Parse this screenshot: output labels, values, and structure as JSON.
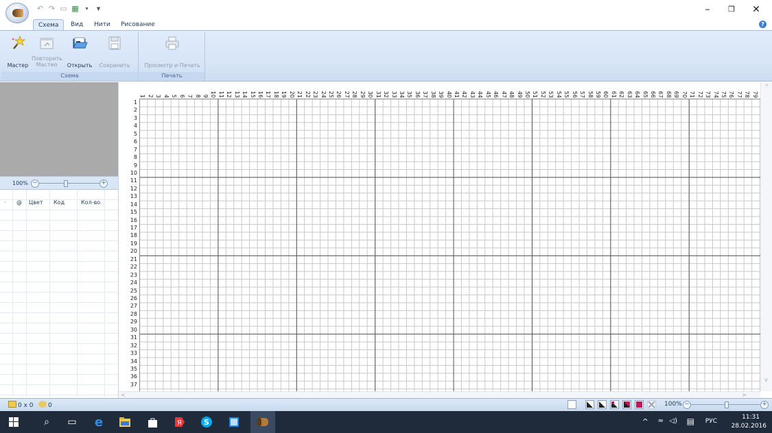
{
  "window": {
    "minimize": "–",
    "maximize": "❐",
    "close": "✕"
  },
  "quick_access": {
    "undo_icon": "undo-icon",
    "redo_icon": "redo-icon",
    "save_icon": "save-icon",
    "thread_icon": "thread-icon",
    "customize": "▾"
  },
  "tabs": [
    {
      "label": "Схема",
      "active": true
    },
    {
      "label": "Вид",
      "active": false
    },
    {
      "label": "Нити",
      "active": false
    },
    {
      "label": "Рисование",
      "active": false
    }
  ],
  "ribbon": {
    "schema_group": {
      "label": "Схема",
      "buttons": [
        {
          "label": "Мастер",
          "enabled": true
        },
        {
          "label": "Повторить Мастео",
          "enabled": false
        },
        {
          "label": "Открыть",
          "enabled": true
        },
        {
          "label": "Сохранить",
          "enabled": false
        }
      ]
    },
    "print_group": {
      "label": "Печать",
      "buttons": [
        {
          "label": "Просмотр и Печать",
          "enabled": false
        }
      ]
    }
  },
  "left_panel": {
    "zoom": "100%",
    "zoom_level": 1.0,
    "table_columns": [
      "·",
      "@",
      "Цвет",
      "Код",
      "Кол-во"
    ]
  },
  "grid": {
    "columns_visible": 79,
    "rows_visible": 37,
    "major_every": 10
  },
  "statusbar": {
    "size": "0 x 0",
    "count": "0",
    "zoom": "100%",
    "zoom_level": 1.0
  },
  "taskbar": {
    "language": "РУС",
    "time": "11:31",
    "date": "28.02.2016"
  },
  "colors": {
    "ribbon_bg": "#dce8f7",
    "accent": "#1e395b",
    "taskbar_bg": "#1f2a3a"
  }
}
